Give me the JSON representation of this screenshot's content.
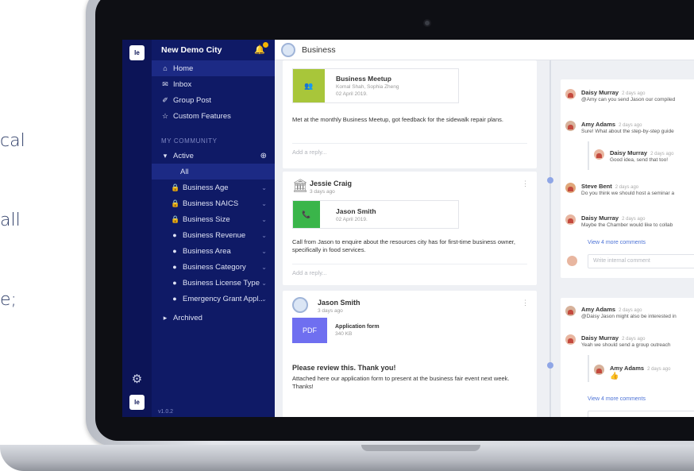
{
  "side_copy": [
    "cal",
    "all",
    "e;"
  ],
  "app": {
    "title": "New Demo City",
    "version": "v1.0.2",
    "logo_text": "le"
  },
  "nav": [
    {
      "icon": "⌂",
      "label": "Home"
    },
    {
      "icon": "✉",
      "label": "Inbox"
    },
    {
      "icon": "✐",
      "label": "Group Post"
    },
    {
      "icon": "☆",
      "label": "Custom Features"
    }
  ],
  "community": {
    "section_label": "MY COMMUNITY",
    "active_label": "Active",
    "all_label": "All",
    "groups": [
      {
        "icon": "🔒",
        "label": "Business Age"
      },
      {
        "icon": "🔒",
        "label": "Business NAICS"
      },
      {
        "icon": "🔒",
        "label": "Business Size"
      },
      {
        "icon": "●",
        "label": "Business Revenue"
      },
      {
        "icon": "●",
        "label": "Business Area"
      },
      {
        "icon": "●",
        "label": "Business Category"
      },
      {
        "icon": "●",
        "label": "Business License Type"
      },
      {
        "icon": "●",
        "label": "Emergency Grant Appl..."
      }
    ],
    "archived_label": "Archived"
  },
  "topbar": {
    "title": "Business"
  },
  "posts": [
    {
      "attach_title": "Business Meetup",
      "attach_sub1": "Komal Shah, Sophia Zheng",
      "attach_sub2": "02 April 2019.",
      "body": "Met at the monthly Business Meetup, got feedback for the sidewalk repair plans.",
      "reply": "Add a reply..."
    },
    {
      "author": "Jessie Craig",
      "ago": "3 days ago",
      "attach_title": "Jason Smith",
      "attach_sub": "02 April 2019.",
      "body": "Call from Jason to enquire about the resources city has for first-time business owner, specifically in food services.",
      "reply": "Add a reply..."
    },
    {
      "author": "Jason Smith",
      "ago": "3 days ago",
      "attach_badge": "PDF",
      "attach_title": "Application form",
      "attach_sub": "340 KB",
      "heading": "Please review this. Thank you!",
      "body": "Attached here our application form to present at the business fair event next week. Thanks!"
    }
  ],
  "comments_top": [
    {
      "name": "Daisy Murray",
      "ago": "2 days ago",
      "text": "@Amy can you send Jason our compiled"
    },
    {
      "name": "Amy Adams",
      "ago": "2 days ago",
      "text": "Sure! What about the step-by-step guide"
    },
    {
      "name": "Daisy Murray",
      "ago": "2 days ago",
      "text": "Good idea, send that too!"
    },
    {
      "name": "Steve Bent",
      "ago": "2 days ago",
      "text": "Do you think we should host a seminar a"
    },
    {
      "name": "Daisy Murray",
      "ago": "2 days ago",
      "text": "Maybe the Chamber would like to collab"
    }
  ],
  "comments_bottom": [
    {
      "name": "Amy Adams",
      "ago": "2 days ago",
      "text": "@Daisy Jason might also be interested in"
    },
    {
      "name": "Daisy Murray",
      "ago": "2 days ago",
      "text": "Yeah we should send a group outreach"
    },
    {
      "name": "Amy Adams",
      "ago": "2 days ago",
      "text": ""
    }
  ],
  "view_more": "View 4 more comments",
  "comment_placeholder": "Write internal comment",
  "colors": {
    "sidebar": "#0f1a66",
    "rail": "#0c1457",
    "meetup_tile": "#a8c63a",
    "call_tile": "#3ab54a",
    "pdf_tile": "#6f6ff0",
    "link": "#4d73d6"
  }
}
